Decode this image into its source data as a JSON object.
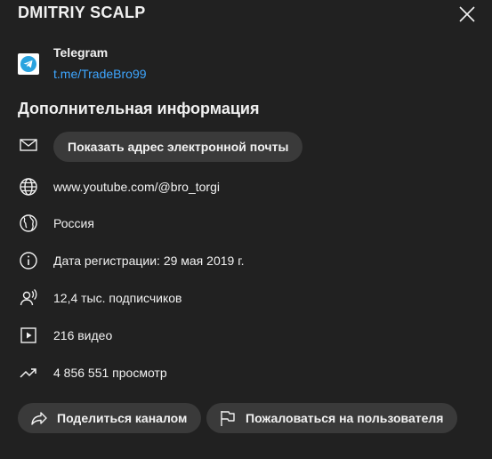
{
  "dialog": {
    "title": "DMITRIY SCALP"
  },
  "links": [
    {
      "name": "Telegram",
      "url": "t.me/TradeBro99",
      "icon": "telegram-icon"
    }
  ],
  "details": {
    "heading": "Дополнительная информация",
    "email_button": "Показать адрес электронной почты",
    "website": "www.youtube.com/@bro_torgi",
    "country": "Россия",
    "joined": "Дата регистрации: 29 мая 2019 г.",
    "subscribers": "12,4 тыс. подписчиков",
    "videos": "216 видео",
    "views": "4 856 551 просмотр"
  },
  "actions": {
    "share": "Поделиться каналом",
    "report": "Пожаловаться на пользователя"
  },
  "colors": {
    "background": "#212121",
    "text": "#f1f1f1",
    "link": "#3ea6ff",
    "button": "#3a3a3a",
    "telegram": "#2aa3df"
  }
}
